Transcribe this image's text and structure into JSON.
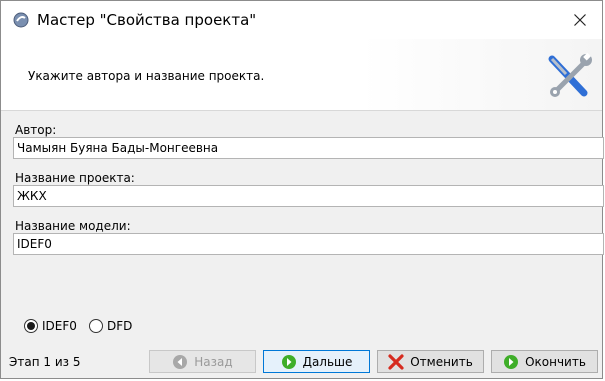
{
  "window": {
    "title": "Мастер \"Свойства проекта\""
  },
  "header": {
    "instruction": "Укажите автора и название проекта."
  },
  "fields": {
    "author": {
      "label": "Автор:",
      "value": "Чамыян Буяна Бады-Монгеевна"
    },
    "project_name": {
      "label": "Название проекта:",
      "value": "ЖКХ"
    },
    "model_name": {
      "label": "Название модели:",
      "value": "IDEF0"
    }
  },
  "method_options": [
    {
      "label": "IDEF0",
      "selected": true
    },
    {
      "label": "DFD",
      "selected": false
    }
  ],
  "step": {
    "text": "Этап 1 из 5"
  },
  "buttons": {
    "back": {
      "label": "Назад",
      "enabled": false
    },
    "next": {
      "label": "Дальше",
      "enabled": true
    },
    "cancel": {
      "label": "Отменить",
      "enabled": true
    },
    "finish": {
      "label": "Окончить",
      "enabled": true
    }
  },
  "colors": {
    "green_icon": "#3fae29",
    "red_icon": "#d62b1f",
    "disabled_icon": "#a8a8a8",
    "focus_border": "#0078d7"
  }
}
